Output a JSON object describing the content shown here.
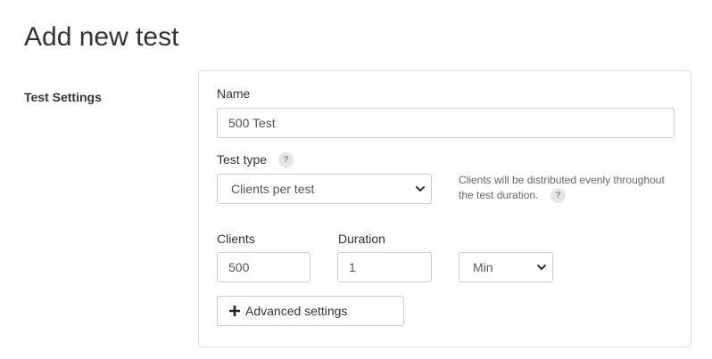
{
  "page": {
    "title": "Add new test",
    "section_label": "Test Settings"
  },
  "form": {
    "name": {
      "label": "Name",
      "value": "500 Test"
    },
    "test_type": {
      "label": "Test type",
      "help_icon": "question-icon",
      "help_glyph": "?",
      "selected": "Clients per test",
      "hint": "Clients will be distributed evenly throughout the test duration.",
      "hint_help_glyph": "?"
    },
    "clients": {
      "label": "Clients",
      "value": "500"
    },
    "duration": {
      "label": "Duration",
      "value": "1",
      "unit_selected": "Min"
    },
    "advanced_button": {
      "label": "Advanced settings",
      "icon": "plus-icon"
    }
  },
  "colors": {
    "border": "#cccccc",
    "panel_border": "#dddddd",
    "text": "#333333",
    "muted": "#666666",
    "badge_bg": "#e6e6e6"
  }
}
